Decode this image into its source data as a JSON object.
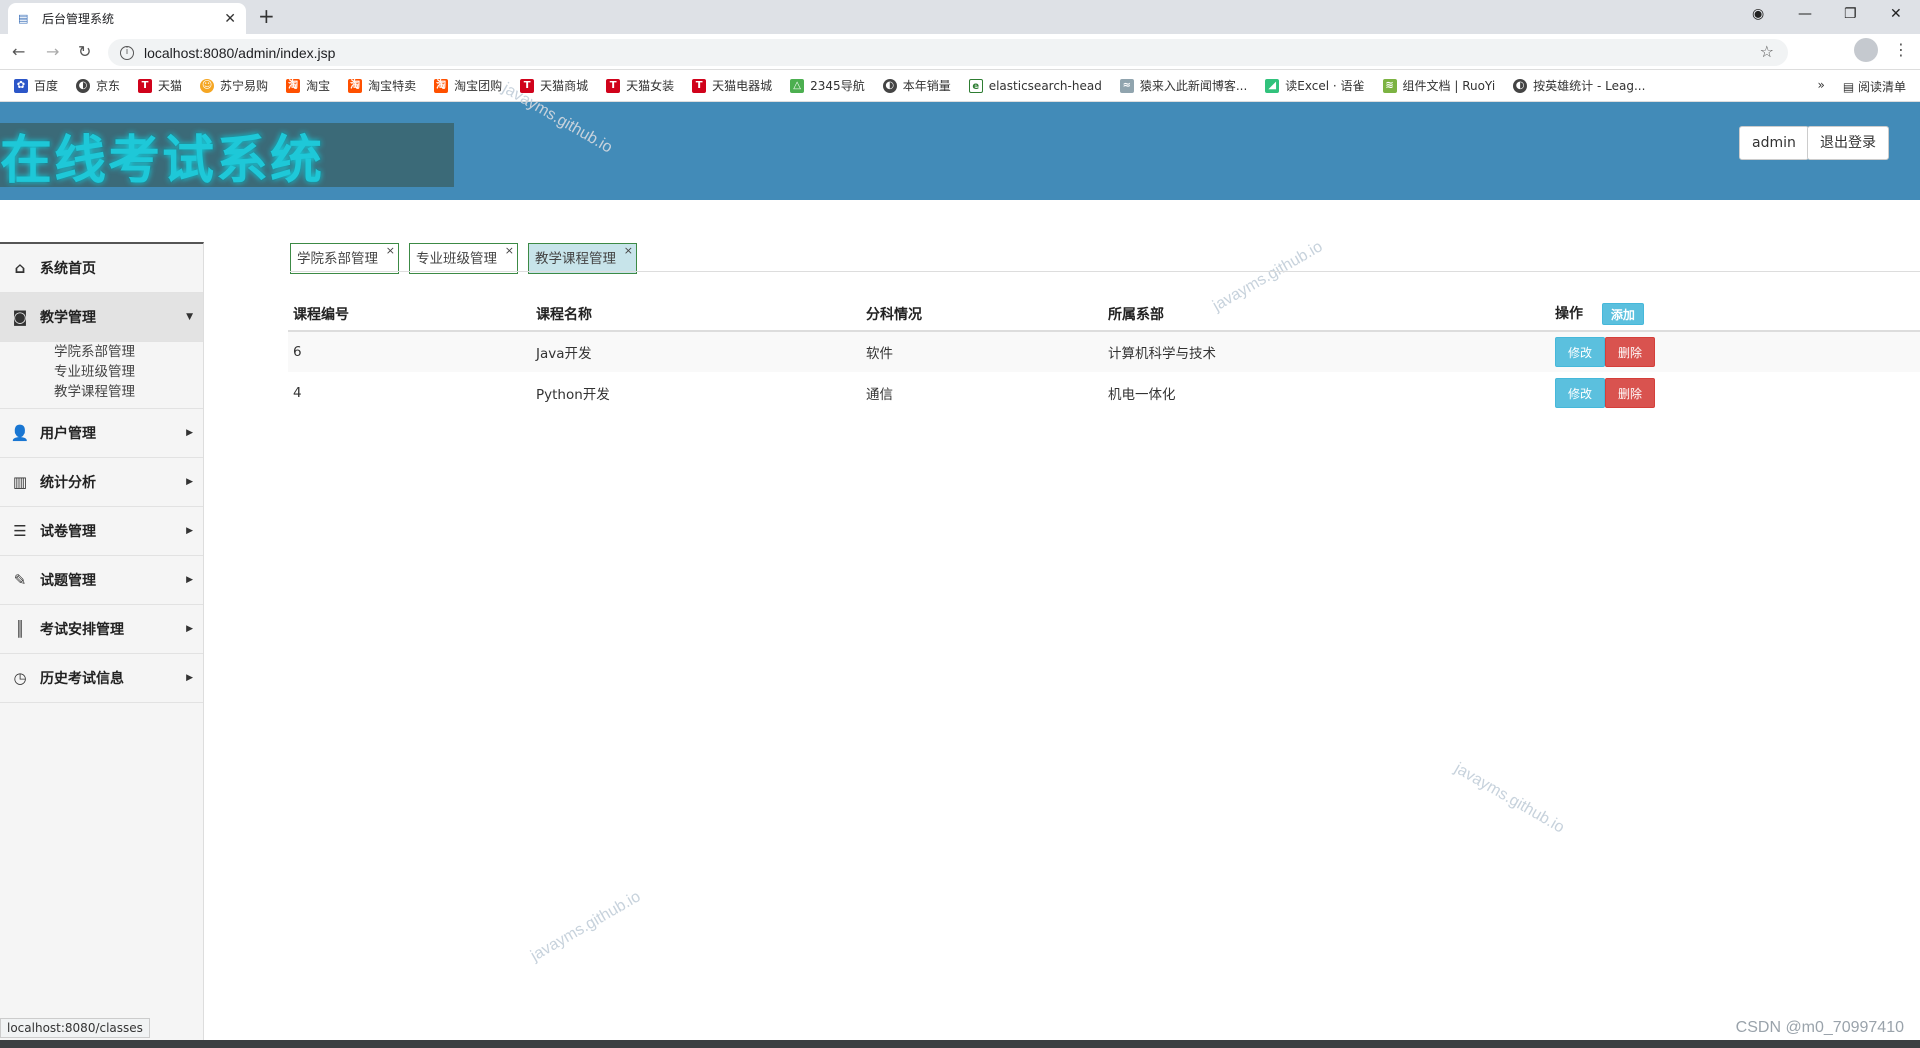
{
  "browser": {
    "tab_title": "后台管理系统",
    "url": "localhost:8080/admin/index.jsp",
    "bookmarks": [
      "百度",
      "京东",
      "天猫",
      "苏宁易购",
      "淘宝",
      "淘宝特卖",
      "淘宝团购",
      "天猫商城",
      "天猫女装",
      "天猫电器城",
      "2345导航",
      "本年销量",
      "elasticsearch-head",
      "猿来入此新闻博客...",
      "读Excel · 语雀",
      "组件文档 | RuoYi",
      "按英雄统计 - Leag..."
    ],
    "bookmarks_more": "»",
    "reading_list": "阅读清单",
    "status_url": "localhost:8080/classes"
  },
  "header": {
    "logo_text": "在线考试系统",
    "user_button": "admin",
    "logout_button": "退出登录"
  },
  "sidebar": {
    "items": [
      {
        "label": "系统首页",
        "icon": "home-icon"
      },
      {
        "label": "教学管理",
        "icon": "monitor-icon"
      },
      {
        "label": "用户管理",
        "icon": "user-icon"
      },
      {
        "label": "统计分析",
        "icon": "chart-icon"
      },
      {
        "label": "试卷管理",
        "icon": "paper-icon"
      },
      {
        "label": "试题管理",
        "icon": "question-icon"
      },
      {
        "label": "考试安排管理",
        "icon": "books-icon"
      },
      {
        "label": "历史考试信息",
        "icon": "clock-icon"
      }
    ],
    "subitems": [
      "学院系部管理",
      "专业班级管理",
      "教学课程管理"
    ]
  },
  "page_tabs": [
    "学院系部管理",
    "专业班级管理",
    "教学课程管理"
  ],
  "table": {
    "headers": [
      "课程编号",
      "课程名称",
      "分科情况",
      "所属系部",
      "操作"
    ],
    "add_button": "添加",
    "edit_button": "修改",
    "delete_button": "删除",
    "rows": [
      {
        "id": "6",
        "name": "Java开发",
        "category": "软件",
        "department": "计算机科学与技术"
      },
      {
        "id": "4",
        "name": "Python开发",
        "category": "通信",
        "department": "机电一体化"
      }
    ]
  },
  "watermark": "javayms.github.io",
  "footer_credit": "CSDN @m0_70997410"
}
